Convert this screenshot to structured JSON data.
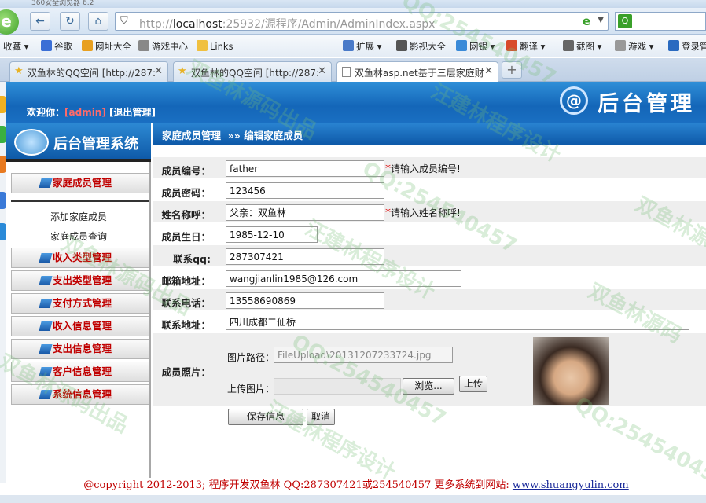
{
  "browser": {
    "title_strip": "360安全浏览器 6.2",
    "address_host": "localhost",
    "address_rest": ":25932/源程序/Admin/AdminIndex.aspx",
    "address_scheme": "http://",
    "bookmarks": [
      "收藏",
      "谷歌",
      "网址大全",
      "游戏中心",
      "Links",
      "扩展",
      "影视大全",
      "网银",
      "翻译",
      "截图",
      "游戏",
      "登录管"
    ],
    "tabs": [
      {
        "label": "双鱼林的QQ空间 [http://287:"
      },
      {
        "label": "双鱼林的QQ空间 [http://287:"
      },
      {
        "label": "双鱼林asp.net基于三层家庭财"
      }
    ]
  },
  "banner": {
    "welcome": "欢迎你：",
    "user": "[admin]",
    "logout": "[退出管理]",
    "title": "后台管理"
  },
  "sidebar": {
    "title": "后台管理系统",
    "menus": [
      {
        "label": "家庭成员管理"
      },
      {
        "label": "收入类型管理"
      },
      {
        "label": "支出类型管理"
      },
      {
        "label": "支付方式管理"
      },
      {
        "label": "收入信息管理"
      },
      {
        "label": "支出信息管理"
      },
      {
        "label": "客户信息管理"
      },
      {
        "label": "系统信息管理"
      }
    ],
    "submenu": [
      "添加家庭成员",
      "家庭成员查询"
    ]
  },
  "breadcrumb": {
    "section": "家庭成员管理",
    "sep": "»»",
    "page": "编辑家庭成员"
  },
  "form": {
    "member_no_label": "成员编号：",
    "member_no": "father",
    "member_no_hint": "请输入成员编号!",
    "password_label": "成员密码：",
    "password": "123456",
    "name_label": "姓名称呼：",
    "name": "父亲：双鱼林",
    "name_hint": "请输入姓名称呼!",
    "birthday_label": "成员生日：",
    "birthday": "1985-12-10",
    "qq_label": "联系qq:",
    "qq": "287307421",
    "email_label": "邮箱地址：",
    "email": "wangjianlin1985@126.com",
    "phone_label": "联系电话：",
    "phone": "13558690869",
    "address_label": "联系地址：",
    "address": "四川成都二仙桥",
    "photo_label": "成员照片：",
    "photo_path_label": "图片路径：",
    "photo_path": "FileUpload\\20131207233724.jpg",
    "upload_label": "上传图片：",
    "browse": "浏览...",
    "upload_btn": "上传",
    "save": "保存信息",
    "cancel": "取消",
    "required_mark": "*"
  },
  "footer": {
    "text": "@copyright 2012-2013; 程序开发双鱼林  QQ:287307421或254540457  更多系统到网站: ",
    "link": "www.shuangyulin.com"
  },
  "watermarks": [
    "QQ:254540457",
    "汪建林程序设计",
    "双鱼林源码出品",
    "QQ:254540457",
    "汪建林程序设计",
    "双鱼林源码出品",
    "QQ:254540457",
    "双鱼林源码",
    "汪建林程序设计",
    "QQ:254540457",
    "双鱼林源码出品",
    "双鱼林源"
  ]
}
